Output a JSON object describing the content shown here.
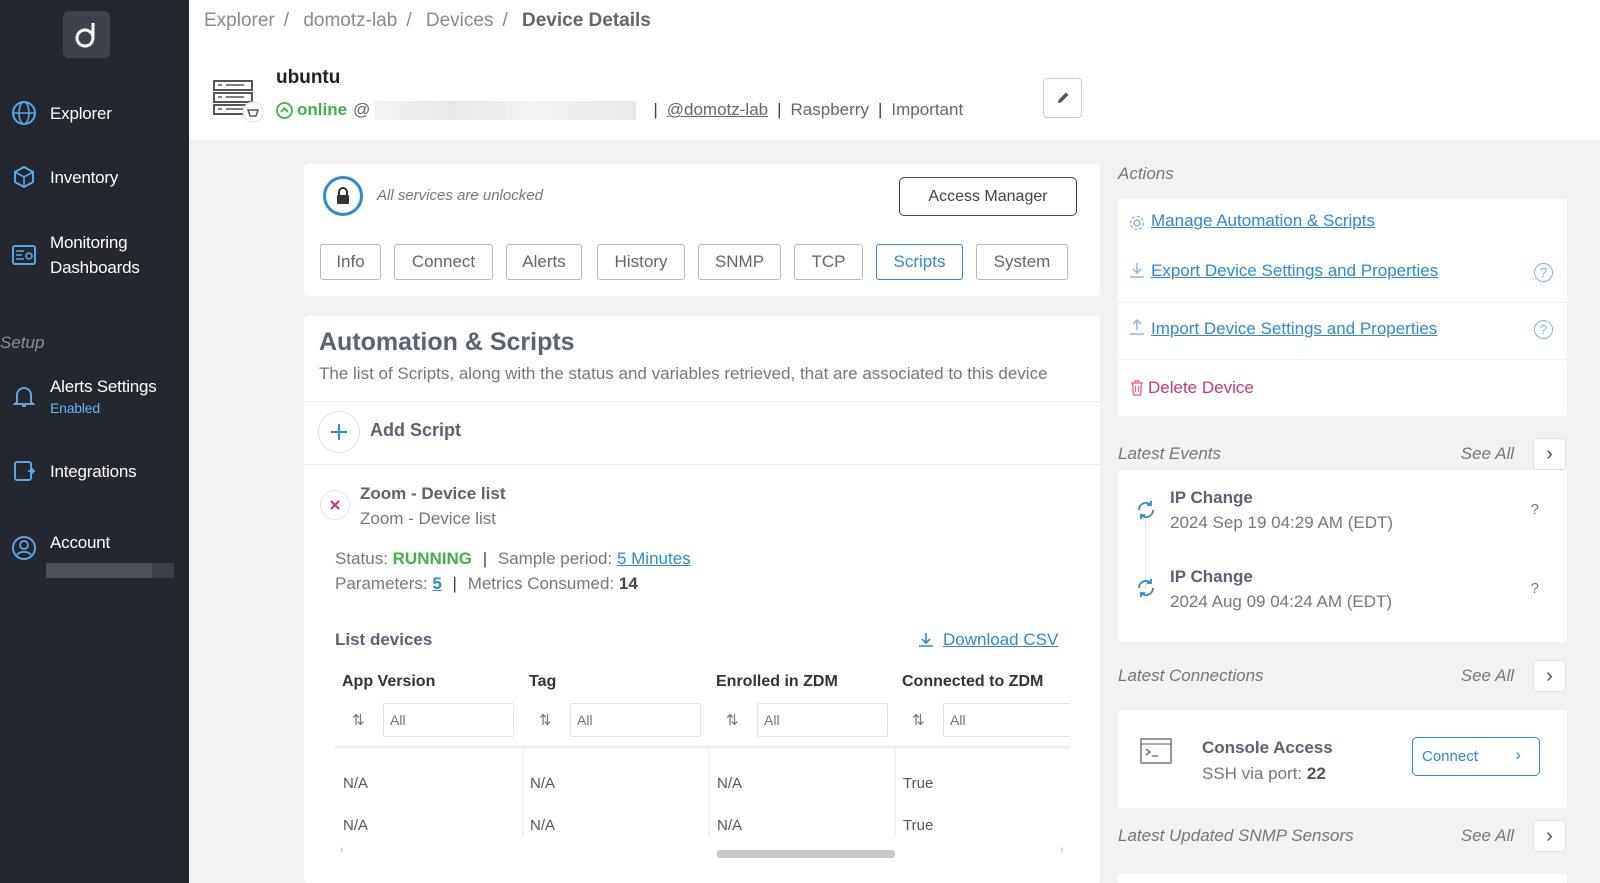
{
  "sidebar": {
    "items": [
      {
        "label": "Explorer",
        "icon": "globe-icon"
      },
      {
        "label": "Inventory",
        "icon": "cubes-icon"
      },
      {
        "label": "Monitoring Dashboards",
        "line1": "Monitoring",
        "line2": "Dashboards",
        "icon": "dashboard-icon"
      },
      {
        "label": "Alerts Settings",
        "sub": "Enabled",
        "icon": "bell-icon"
      },
      {
        "label": "Integrations",
        "icon": "integrations-icon"
      },
      {
        "label": "Account",
        "icon": "user-icon"
      }
    ],
    "setup_label": "Setup"
  },
  "breadcrumb": [
    "Explorer",
    "domotz-lab",
    "Devices",
    "Device Details"
  ],
  "device": {
    "name": "ubuntu",
    "status": "online",
    "at": "@",
    "agent": "@domotz-lab",
    "tags": [
      "Raspberry",
      "Important"
    ]
  },
  "services": {
    "text": "All services are unlocked",
    "access_manager": "Access Manager"
  },
  "tabs": [
    "Info",
    "Connect",
    "Alerts",
    "History",
    "SNMP",
    "TCP",
    "Scripts",
    "System"
  ],
  "active_tab": "Scripts",
  "scripts": {
    "title": "Automation & Scripts",
    "description": "The list of Scripts, along with the status and variables retrieved, that are associated to this device",
    "add_label": "Add Script",
    "item": {
      "name": "Zoom - Device list",
      "subtitle": "Zoom - Device list",
      "status_label": "Status:",
      "status_value": "RUNNING",
      "sample_label": "Sample period:",
      "sample_value": "5 Minutes",
      "params_label": "Parameters:",
      "params_value": "5",
      "metrics_label": "Metrics Consumed:",
      "metrics_value": "14"
    },
    "list_title": "List devices",
    "download": "Download CSV",
    "columns": [
      "App Version",
      "Tag",
      "Enrolled in ZDM",
      "Connected to ZDM"
    ],
    "filter_placeholder": "All",
    "rows": [
      [
        "N/A",
        "N/A",
        "N/A",
        "True"
      ],
      [
        "N/A",
        "N/A",
        "N/A",
        "True"
      ]
    ]
  },
  "actions": {
    "title": "Actions",
    "items": [
      {
        "label": "Manage Automation & Scripts",
        "icon": "gear-icon",
        "color": "#2a8bd6"
      },
      {
        "label": "Export Device Settings and Properties",
        "icon": "download-icon",
        "color": "#2a8bd6"
      },
      {
        "label": "Import Device Settings and Properties",
        "icon": "upload-icon",
        "color": "#2a8bd6"
      },
      {
        "label": "Delete Device",
        "icon": "trash-icon",
        "color": "#d6336c"
      }
    ]
  },
  "events": {
    "title": "Latest Events",
    "see_all": "See All",
    "items": [
      {
        "title": "IP Change",
        "date": "2024 Sep 19 04:29 AM (EDT)",
        "q": "?"
      },
      {
        "title": "IP Change",
        "date": "2024 Aug 09 04:24 AM (EDT)",
        "q": "?"
      }
    ]
  },
  "connections": {
    "title": "Latest Connections",
    "see_all": "See All",
    "item": {
      "title": "Console Access",
      "sub_label": "SSH via port:",
      "port": "22",
      "button": "Connect"
    }
  },
  "snmp": {
    "title": "Latest Updated SNMP Sensors",
    "see_all": "See All"
  },
  "colors": {
    "accent": "#2a8bd6",
    "online": "#3db34a",
    "danger": "#d6336c",
    "sidebar": "#24272e"
  }
}
